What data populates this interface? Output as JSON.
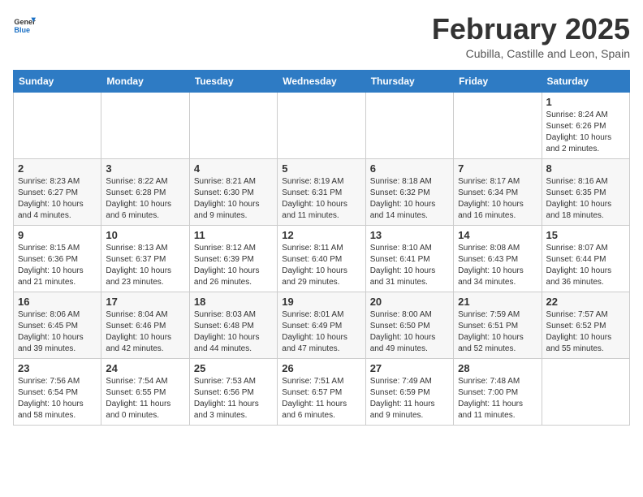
{
  "header": {
    "logo_line1": "General",
    "logo_line2": "Blue",
    "month_title": "February 2025",
    "location": "Cubilla, Castille and Leon, Spain"
  },
  "weekdays": [
    "Sunday",
    "Monday",
    "Tuesday",
    "Wednesday",
    "Thursday",
    "Friday",
    "Saturday"
  ],
  "weeks": [
    [
      {
        "day": "",
        "info": ""
      },
      {
        "day": "",
        "info": ""
      },
      {
        "day": "",
        "info": ""
      },
      {
        "day": "",
        "info": ""
      },
      {
        "day": "",
        "info": ""
      },
      {
        "day": "",
        "info": ""
      },
      {
        "day": "1",
        "info": "Sunrise: 8:24 AM\nSunset: 6:26 PM\nDaylight: 10 hours\nand 2 minutes."
      }
    ],
    [
      {
        "day": "2",
        "info": "Sunrise: 8:23 AM\nSunset: 6:27 PM\nDaylight: 10 hours\nand 4 minutes."
      },
      {
        "day": "3",
        "info": "Sunrise: 8:22 AM\nSunset: 6:28 PM\nDaylight: 10 hours\nand 6 minutes."
      },
      {
        "day": "4",
        "info": "Sunrise: 8:21 AM\nSunset: 6:30 PM\nDaylight: 10 hours\nand 9 minutes."
      },
      {
        "day": "5",
        "info": "Sunrise: 8:19 AM\nSunset: 6:31 PM\nDaylight: 10 hours\nand 11 minutes."
      },
      {
        "day": "6",
        "info": "Sunrise: 8:18 AM\nSunset: 6:32 PM\nDaylight: 10 hours\nand 14 minutes."
      },
      {
        "day": "7",
        "info": "Sunrise: 8:17 AM\nSunset: 6:34 PM\nDaylight: 10 hours\nand 16 minutes."
      },
      {
        "day": "8",
        "info": "Sunrise: 8:16 AM\nSunset: 6:35 PM\nDaylight: 10 hours\nand 18 minutes."
      }
    ],
    [
      {
        "day": "9",
        "info": "Sunrise: 8:15 AM\nSunset: 6:36 PM\nDaylight: 10 hours\nand 21 minutes."
      },
      {
        "day": "10",
        "info": "Sunrise: 8:13 AM\nSunset: 6:37 PM\nDaylight: 10 hours\nand 23 minutes."
      },
      {
        "day": "11",
        "info": "Sunrise: 8:12 AM\nSunset: 6:39 PM\nDaylight: 10 hours\nand 26 minutes."
      },
      {
        "day": "12",
        "info": "Sunrise: 8:11 AM\nSunset: 6:40 PM\nDaylight: 10 hours\nand 29 minutes."
      },
      {
        "day": "13",
        "info": "Sunrise: 8:10 AM\nSunset: 6:41 PM\nDaylight: 10 hours\nand 31 minutes."
      },
      {
        "day": "14",
        "info": "Sunrise: 8:08 AM\nSunset: 6:43 PM\nDaylight: 10 hours\nand 34 minutes."
      },
      {
        "day": "15",
        "info": "Sunrise: 8:07 AM\nSunset: 6:44 PM\nDaylight: 10 hours\nand 36 minutes."
      }
    ],
    [
      {
        "day": "16",
        "info": "Sunrise: 8:06 AM\nSunset: 6:45 PM\nDaylight: 10 hours\nand 39 minutes."
      },
      {
        "day": "17",
        "info": "Sunrise: 8:04 AM\nSunset: 6:46 PM\nDaylight: 10 hours\nand 42 minutes."
      },
      {
        "day": "18",
        "info": "Sunrise: 8:03 AM\nSunset: 6:48 PM\nDaylight: 10 hours\nand 44 minutes."
      },
      {
        "day": "19",
        "info": "Sunrise: 8:01 AM\nSunset: 6:49 PM\nDaylight: 10 hours\nand 47 minutes."
      },
      {
        "day": "20",
        "info": "Sunrise: 8:00 AM\nSunset: 6:50 PM\nDaylight: 10 hours\nand 49 minutes."
      },
      {
        "day": "21",
        "info": "Sunrise: 7:59 AM\nSunset: 6:51 PM\nDaylight: 10 hours\nand 52 minutes."
      },
      {
        "day": "22",
        "info": "Sunrise: 7:57 AM\nSunset: 6:52 PM\nDaylight: 10 hours\nand 55 minutes."
      }
    ],
    [
      {
        "day": "23",
        "info": "Sunrise: 7:56 AM\nSunset: 6:54 PM\nDaylight: 10 hours\nand 58 minutes."
      },
      {
        "day": "24",
        "info": "Sunrise: 7:54 AM\nSunset: 6:55 PM\nDaylight: 11 hours\nand 0 minutes."
      },
      {
        "day": "25",
        "info": "Sunrise: 7:53 AM\nSunset: 6:56 PM\nDaylight: 11 hours\nand 3 minutes."
      },
      {
        "day": "26",
        "info": "Sunrise: 7:51 AM\nSunset: 6:57 PM\nDaylight: 11 hours\nand 6 minutes."
      },
      {
        "day": "27",
        "info": "Sunrise: 7:49 AM\nSunset: 6:59 PM\nDaylight: 11 hours\nand 9 minutes."
      },
      {
        "day": "28",
        "info": "Sunrise: 7:48 AM\nSunset: 7:00 PM\nDaylight: 11 hours\nand 11 minutes."
      },
      {
        "day": "",
        "info": ""
      }
    ]
  ]
}
